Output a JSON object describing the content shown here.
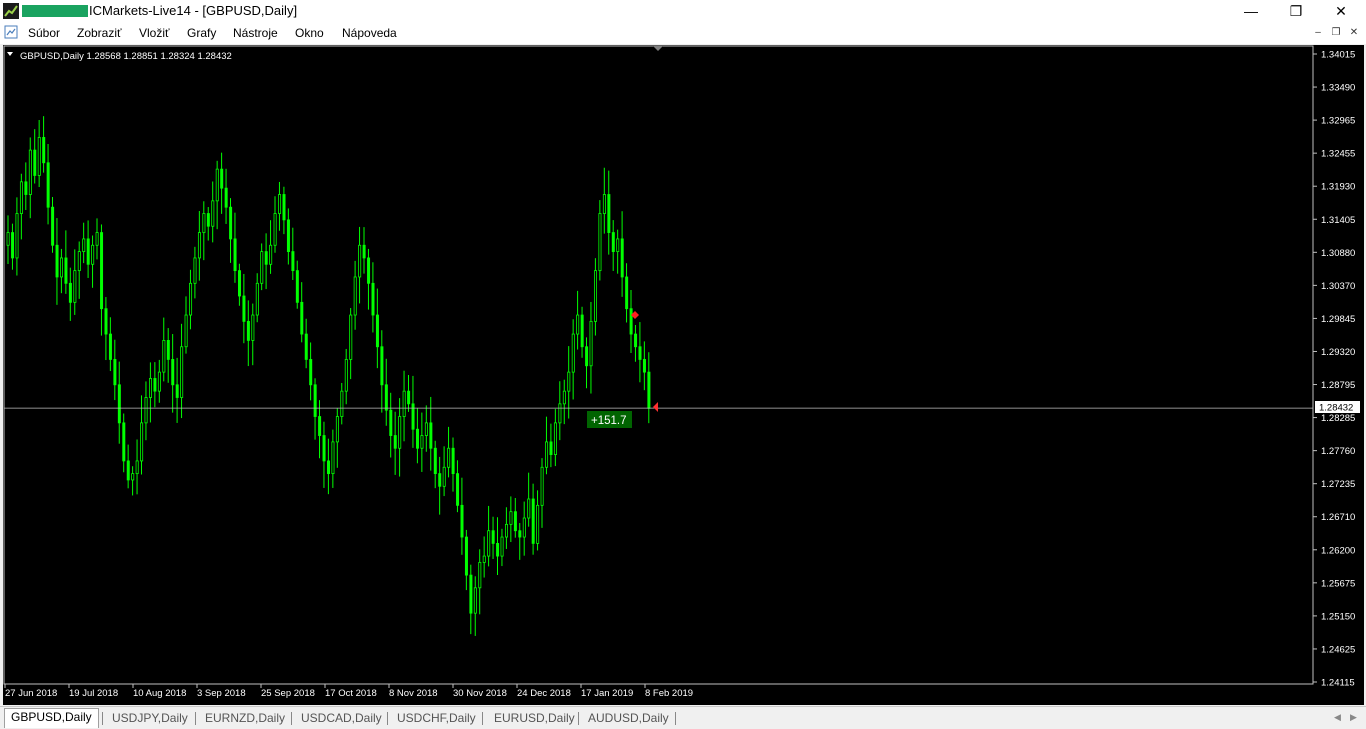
{
  "window": {
    "title": "ICMarkets-Live14 - [GBPUSD,Daily]",
    "minimize_glyph": "—",
    "maximize_glyph": "❐",
    "close_glyph": "✕"
  },
  "menu": {
    "items": [
      "Súbor",
      "Zobraziť",
      "Vložiť",
      "Grafy",
      "Nástroje",
      "Okno",
      "Nápoveda"
    ]
  },
  "chart_data": {
    "type": "candlestick",
    "symbol_header": "GBPUSD,Daily  1.28568 1.28851 1.28324 1.28432",
    "price_line": "1.28432",
    "profit_label": "+151.7",
    "y_ticks": [
      "1.34015",
      "1.33490",
      "1.32965",
      "1.32455",
      "1.31930",
      "1.31405",
      "1.30880",
      "1.30370",
      "1.29845",
      "1.29320",
      "1.28795",
      "1.28285",
      "1.27760",
      "1.27235",
      "1.26710",
      "1.26200",
      "1.25675",
      "1.25150",
      "1.24625",
      "1.24115"
    ],
    "x_ticks": [
      "27 Jun 2018",
      "19 Jul 2018",
      "10 Aug 2018",
      "3 Sep 2018",
      "25 Sep 2018",
      "17 Oct 2018",
      "8 Nov 2018",
      "30 Nov 2018",
      "24 Dec 2018",
      "17 Jan 2019",
      "8 Feb 2019"
    ],
    "ylim": [
      1.24115,
      1.34015
    ],
    "bull_color": "#00ff00",
    "bear_color": "#00ff00",
    "background": "#000000",
    "closes": [
      1.312,
      1.308,
      1.315,
      1.32,
      1.318,
      1.325,
      1.321,
      1.327,
      1.323,
      1.316,
      1.31,
      1.305,
      1.308,
      1.304,
      1.301,
      1.306,
      1.309,
      1.311,
      1.307,
      1.31,
      1.312,
      1.3,
      1.296,
      1.292,
      1.288,
      1.282,
      1.276,
      1.273,
      1.274,
      1.276,
      1.282,
      1.286,
      1.289,
      1.287,
      1.29,
      1.295,
      1.292,
      1.288,
      1.286,
      1.294,
      1.299,
      1.304,
      1.308,
      1.312,
      1.315,
      1.313,
      1.317,
      1.322,
      1.319,
      1.316,
      1.311,
      1.306,
      1.302,
      1.298,
      1.295,
      1.299,
      1.304,
      1.309,
      1.307,
      1.31,
      1.315,
      1.318,
      1.314,
      1.309,
      1.306,
      1.301,
      1.296,
      1.292,
      1.288,
      1.283,
      1.28,
      1.276,
      1.274,
      1.279,
      1.283,
      1.287,
      1.292,
      1.299,
      1.305,
      1.31,
      1.308,
      1.304,
      1.299,
      1.294,
      1.288,
      1.284,
      1.28,
      1.278,
      1.283,
      1.287,
      1.285,
      1.281,
      1.278,
      1.28,
      1.282,
      1.278,
      1.274,
      1.272,
      1.275,
      1.278,
      1.274,
      1.269,
      1.264,
      1.258,
      1.252,
      1.256,
      1.26,
      1.261,
      1.265,
      1.263,
      1.261,
      1.264,
      1.266,
      1.268,
      1.265,
      1.264,
      1.267,
      1.27,
      1.263,
      1.269,
      1.275,
      1.279,
      1.277,
      1.282,
      1.285,
      1.287,
      1.29,
      1.296,
      1.299,
      1.294,
      1.291,
      1.298,
      1.306,
      1.315,
      1.318,
      1.312,
      1.309,
      1.311,
      1.305,
      1.3,
      1.296,
      1.294,
      1.292,
      1.29,
      1.2843
    ]
  },
  "tabs": [
    "GBPUSD,Daily",
    "USDJPY,Daily",
    "EURNZD,Daily",
    "USDCAD,Daily",
    "USDCHF,Daily",
    "EURUSD,Daily",
    "AUDUSD,Daily"
  ]
}
